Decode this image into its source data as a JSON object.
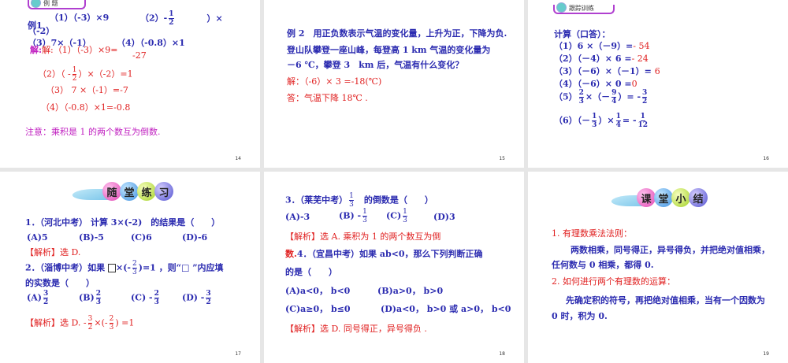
{
  "slides": [
    {
      "number": "14",
      "badge": "例 题",
      "ex_label": "例1",
      "q1": "（1）（-3）×9",
      "q2a": "（2）-",
      "q2f": [
        "1",
        "2"
      ],
      "q2b": "）×",
      "q2c": "（-2）",
      "q3": "（3）7×（-1）",
      "q4": "（4）（-0.8）×1",
      "sol1": "解:（1）（-3）×9=",
      "sol1b": "-27",
      "sol2a": "（2）（ -",
      "sol2f": [
        "1",
        "2"
      ],
      "sol2b": "）×（-2）=1",
      "sol3": "（3） 7 ×（-1）=-7",
      "sol4": "（4）（-0.8）×1=-0.8",
      "note": "注意：乘积是 1 的两个数互为倒数."
    },
    {
      "number": "15",
      "l1": "例 2　用正负数表示气温的变化量，上升为正，下降为负.",
      "l2": "登山队攀登一座山峰，每登高 1 km 气温的变化量为",
      "l3": "－6 ℃，攀登 3　km 后，气温有什么变化？",
      "sol": "解：（-6）× 3 =-18(℃)",
      "ans": "答：气温下降 18℃ ."
    },
    {
      "number": "16",
      "badge": "跟踪训练",
      "title": "计算（口答）：",
      "rows": [
        {
          "q": "（1）6 ×（－9）=",
          "a": "- 54"
        },
        {
          "q": "（2）（－4）× 6 =",
          "a": "- 24"
        },
        {
          "q": "（3）（－6）×（－1）=",
          "a": "6"
        },
        {
          "q": "（4）（－6）× 0 =",
          "a": "0"
        }
      ],
      "r5": {
        "label": "（5）",
        "f1": [
          "2",
          "3"
        ],
        "mid": "×（－",
        "f2": [
          "9",
          "4"
        ],
        "end": "）= -",
        "f3": [
          "3",
          "2"
        ]
      },
      "r6": {
        "label": "（6）（－",
        "f1": [
          "1",
          "3"
        ],
        "mid": "）×",
        "f2": [
          "1",
          "4"
        ],
        "end": "= -",
        "f3": [
          "1",
          "12"
        ]
      }
    },
    {
      "number": "17",
      "balls": [
        "随",
        "堂",
        "练",
        "习"
      ],
      "q1": "1．（河北中考） 计算 3×(-2)　的结果是（　　）",
      "q1opts": [
        "(A)5",
        "(B)-5",
        "(C)6",
        "(D)-6"
      ],
      "a1": "【解析】选 D.",
      "q2a": "2．（淄博中考）如果",
      "q2f": [
        "2",
        "3"
      ],
      "q2b": "=1 ，则“□ ”内应填",
      "q2c": "的实数是（　　）",
      "q2opts": [
        {
          "l": "(A)",
          "s": "",
          "f": [
            "3",
            "2"
          ]
        },
        {
          "l": "(B)",
          "s": "",
          "f": [
            "2",
            "3"
          ]
        },
        {
          "l": "(C)",
          "s": "-",
          "f": [
            "2",
            "3"
          ]
        },
        {
          "l": "(D)",
          "s": "-",
          "f": [
            "3",
            "2"
          ]
        }
      ],
      "a2": "【解析】选 D. -",
      "a2f1": [
        "3",
        "2"
      ],
      "a2m": "×(-",
      "a2f2": [
        "2",
        "3"
      ],
      "a2e": ") =1"
    },
    {
      "number": "18",
      "q3a": "3．（莱芜中考）",
      "q3f": [
        "1",
        "3"
      ],
      "q3b": "的倒数是（　　）",
      "q3opts": [
        {
          "l": "(A)-3",
          "f": null
        },
        {
          "l": "(B) -",
          "f": [
            "1",
            "3"
          ]
        },
        {
          "l": "(C)",
          "f": [
            "1",
            "3"
          ]
        },
        {
          "l": "(D)3",
          "f": null
        }
      ],
      "a3": "【解析】选 A. 乘积为 1 的两个数互为倒",
      "a3b": "数.",
      "q4": "4．（宜昌中考）如果 ab<0，那么下列判断正确",
      "q4b": "的是（　　）",
      "q4opts": [
        "(A)a<0， b<0",
        "(B)a>0， b>0",
        "(C)a≥0， b≤0",
        "(D)a<0， b>0 或 a>0， b<0"
      ],
      "a4": "【解析】选 D. 同号得正，异号得负 ."
    },
    {
      "number": "19",
      "balls": [
        "课",
        "堂",
        "小",
        "结"
      ],
      "h1": "1. 有理数乘法法则：",
      "p1": "两数相乘，同号得正，异号得负，并把绝对值相乘，",
      "p1b": "任何数与 0 相乘，都得 0.",
      "h2": "2. 如何进行两个有理数的运算：",
      "p2": "先确定积的符号，再把绝对值相乘，当有一个因数为",
      "p2b": "0 时，积为 0."
    }
  ]
}
